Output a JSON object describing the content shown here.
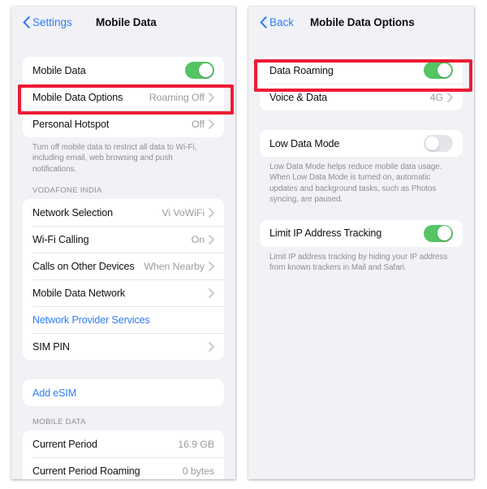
{
  "colors": {
    "accent_blue": "#2f7cf6",
    "toggle_on_green": "#55c465",
    "annotation_red": "#ed1b35",
    "panel_background": "#f1f1f6",
    "card_background": "#ffffff",
    "secondary_text": "#8e8e93"
  },
  "left_panel": {
    "nav": {
      "back_label": "Settings",
      "title": "Mobile Data"
    },
    "group_1": {
      "rows": [
        {
          "label": "Mobile Data",
          "control": "switch",
          "switch_state": "on"
        },
        {
          "label": "Mobile Data Options",
          "value": "Roaming Off",
          "control": "chevron"
        },
        {
          "label": "Personal Hotspot",
          "value": "Off",
          "control": "chevron"
        }
      ],
      "footer": "Turn off mobile data to restrict all data to Wi-Fi, including email, web browsing and push notifications."
    },
    "group_2": {
      "header": "VODAFONE INDIA",
      "rows": [
        {
          "label": "Network Selection",
          "value": "Vi VoWiFi",
          "control": "chevron"
        },
        {
          "label": "Wi-Fi Calling",
          "value": "On",
          "control": "chevron"
        },
        {
          "label": "Calls on Other Devices",
          "value": "When Nearby",
          "control": "chevron"
        },
        {
          "label": "Mobile Data Network",
          "value": "",
          "control": "chevron"
        },
        {
          "label": "Network Provider Services",
          "value": "",
          "control": "none",
          "style": "link"
        },
        {
          "label": "SIM PIN",
          "value": "",
          "control": "chevron"
        }
      ]
    },
    "group_3": {
      "rows": [
        {
          "label": "Add eSIM",
          "value": "",
          "control": "none",
          "style": "link"
        }
      ]
    },
    "group_4": {
      "header": "MOBILE DATA",
      "rows": [
        {
          "label": "Current Period",
          "value": "16.9 GB",
          "control": "none"
        },
        {
          "label": "Current Period Roaming",
          "value": "0 bytes",
          "control": "none"
        }
      ]
    }
  },
  "right_panel": {
    "nav": {
      "back_label": "Back",
      "title": "Mobile Data Options"
    },
    "group_1": {
      "rows": [
        {
          "label": "Data Roaming",
          "control": "switch",
          "switch_state": "on"
        },
        {
          "label": "Voice & Data",
          "value": "4G",
          "control": "chevron"
        }
      ]
    },
    "group_2": {
      "rows": [
        {
          "label": "Low Data Mode",
          "control": "switch",
          "switch_state": "off"
        }
      ],
      "footer": "Low Data Mode helps reduce mobile data usage. When Low Data Mode is turned on, automatic updates and background tasks, such as Photos syncing, are paused."
    },
    "group_3": {
      "rows": [
        {
          "label": "Limit IP Address Tracking",
          "control": "switch",
          "switch_state": "on"
        }
      ],
      "footer": "Limit IP address tracking by hiding your IP address from known trackers in Mail and Safari."
    }
  },
  "annotations": [
    {
      "name": "mobile-data-options-highlight",
      "target": "Mobile Data Options"
    },
    {
      "name": "data-roaming-highlight",
      "target": "Data Roaming"
    }
  ]
}
